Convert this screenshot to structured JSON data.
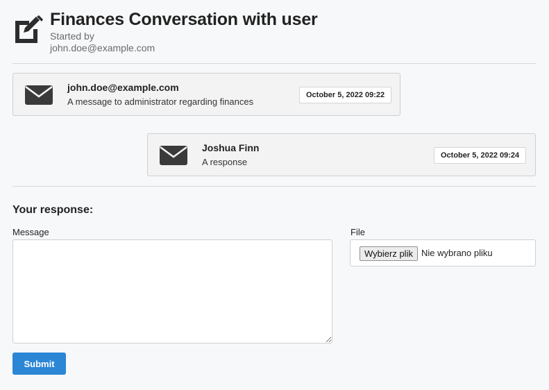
{
  "header": {
    "title": "Finances Conversation with user",
    "started_by_label": "Started by",
    "started_by_email": "john.doe@example.com"
  },
  "messages": [
    {
      "sender": "john.doe@example.com",
      "text": "A message to administrator regarding finances",
      "date": "October 5, 2022 09:22",
      "icon": "envelope-icon"
    },
    {
      "sender": "Joshua Finn",
      "text": "A response",
      "date": "October 5, 2022 09:24",
      "icon": "envelope-icon"
    }
  ],
  "form": {
    "heading": "Your response:",
    "message_label": "Message",
    "message_value": "",
    "file_label": "File",
    "file_button": "Wybierz plik",
    "file_status": "Nie wybrano pliku",
    "submit_label": "Submit"
  },
  "colors": {
    "accent": "#2b86d6",
    "icon": "#3a3a3a",
    "background": "#f7f8fa"
  }
}
